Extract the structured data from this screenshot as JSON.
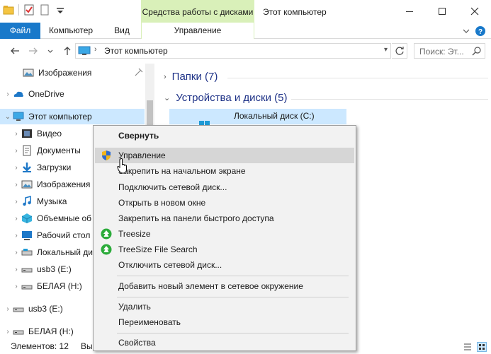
{
  "window": {
    "title": "Этот компьютер",
    "context_tab_header": "Средства работы с дисками",
    "controls": [
      "minimize",
      "maximize",
      "close"
    ]
  },
  "ribbon": {
    "tabs": [
      "Файл",
      "Компьютер",
      "Вид",
      "Управление"
    ],
    "active_color": "#1979ca",
    "context_color": "#d9f0b9"
  },
  "address_bar": {
    "path": "Этот компьютер",
    "search_placeholder": "Поиск: Эт..."
  },
  "nav_pane": {
    "items": [
      {
        "label": "Изображения",
        "icon": "pictures-icon",
        "pinned": true
      },
      {
        "label": "OneDrive",
        "icon": "onedrive-icon"
      },
      {
        "label": "Этот компьютер",
        "icon": "computer-icon",
        "selected": true
      },
      {
        "label": "Видео",
        "icon": "video-icon"
      },
      {
        "label": "Документы",
        "icon": "documents-icon"
      },
      {
        "label": "Загрузки",
        "icon": "downloads-icon"
      },
      {
        "label": "Изображения",
        "icon": "pictures-icon"
      },
      {
        "label": "Музыка",
        "icon": "music-icon"
      },
      {
        "label": "Объемные об",
        "icon": "3d-objects-icon"
      },
      {
        "label": "Рабочий стол",
        "icon": "desktop-icon"
      },
      {
        "label": "Локальный ди",
        "icon": "drive-icon"
      },
      {
        "label": "usb3 (E:)",
        "icon": "usb-drive-icon"
      },
      {
        "label": "БЕЛАЯ (H:)",
        "icon": "usb-drive-icon"
      },
      {
        "label": "usb3 (E:)",
        "icon": "usb-drive-icon"
      },
      {
        "label": "БЕЛАЯ (H:)",
        "icon": "usb-drive-icon"
      }
    ]
  },
  "content": {
    "groups": [
      {
        "label": "Папки (7)",
        "expanded": false
      },
      {
        "label": "Устройства и диски (5)",
        "expanded": true
      }
    ],
    "selected_drive": "Локальный диск (C:)"
  },
  "status_bar": {
    "items_count": "Элементов: 12",
    "selected": "Вы"
  },
  "context_menu": {
    "items": [
      {
        "label": "Свернуть",
        "bold": true
      },
      {
        "label": "Управление",
        "icon": "shield-icon",
        "hover": true
      },
      {
        "label": "Закрепить на начальном экране"
      },
      {
        "label": "Подключить сетевой диск..."
      },
      {
        "label": "Открыть в новом окне"
      },
      {
        "label": "Закрепить на панели быстрого доступа"
      },
      {
        "label": "Treesize",
        "icon": "treesize-icon"
      },
      {
        "label": "TreeSize File Search",
        "icon": "treesize-icon"
      },
      {
        "label": "Отключить сетевой диск..."
      },
      {
        "label": "Добавить новый элемент в сетевое окружение"
      },
      {
        "label": "Удалить"
      },
      {
        "label": "Переименовать"
      },
      {
        "label": "Свойства"
      }
    ]
  }
}
